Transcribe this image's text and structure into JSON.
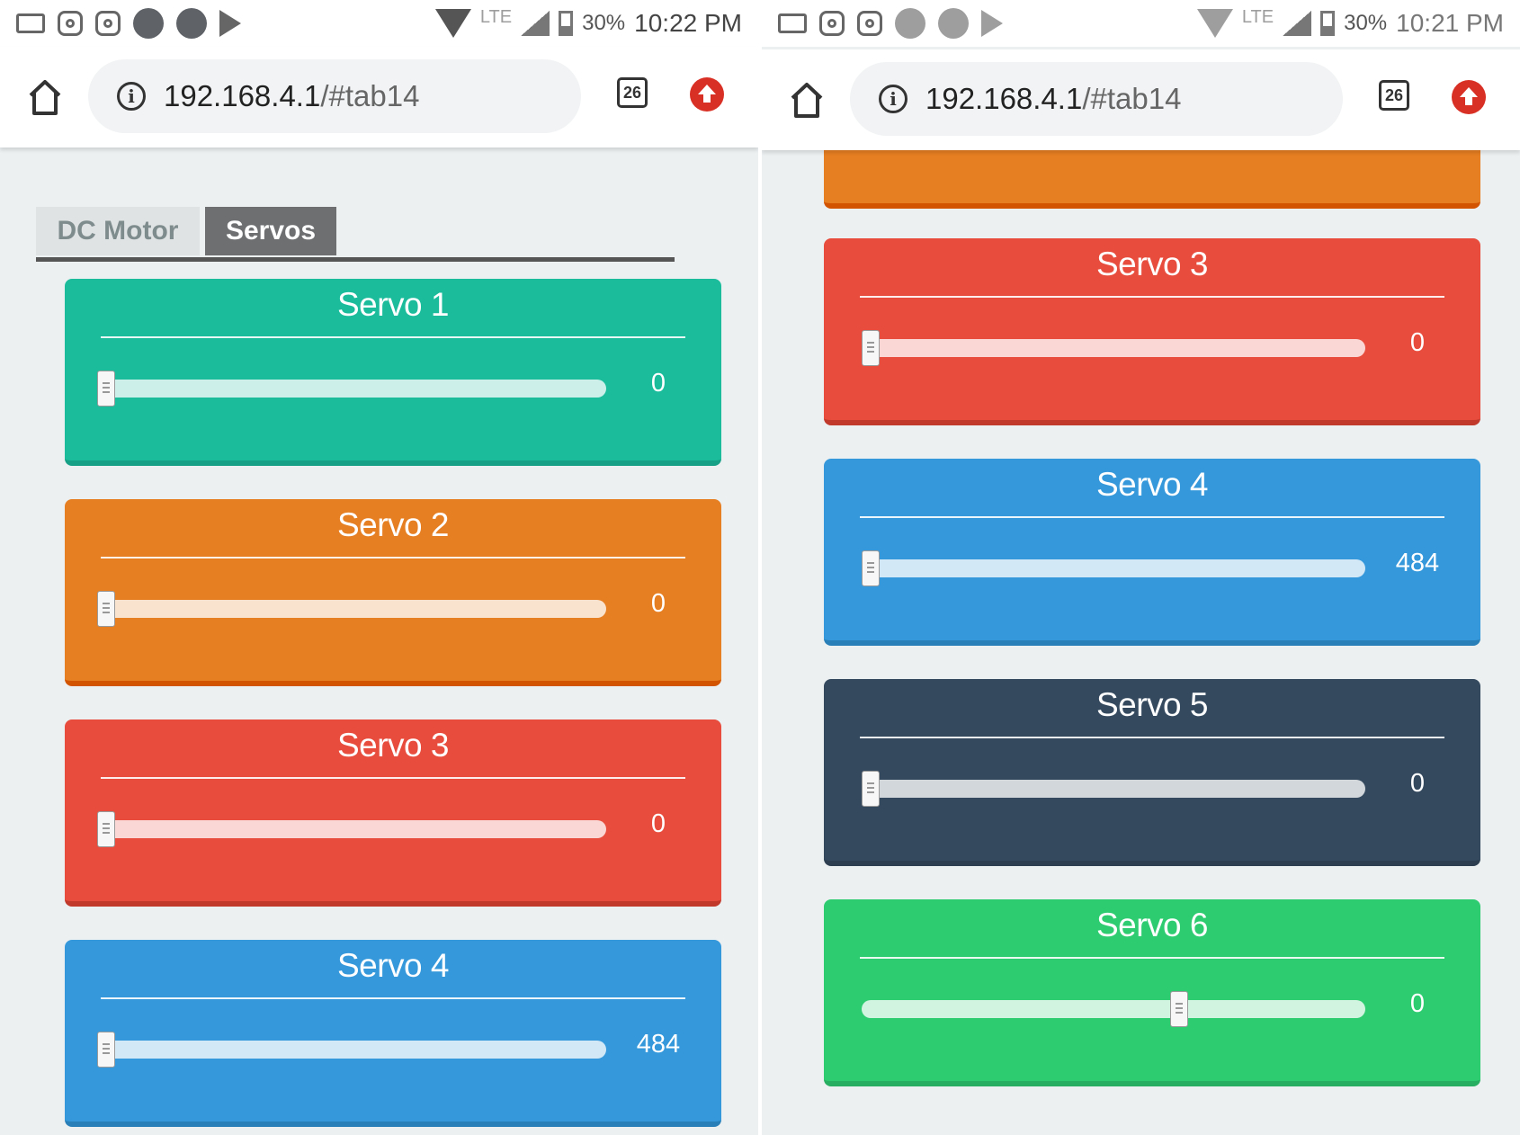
{
  "left": {
    "status": {
      "battery": "30%",
      "time": "10:22 PM",
      "network": "LTE"
    },
    "browser": {
      "url_host": "192.168.4.1",
      "url_path": "/#tab14",
      "tab_count": "26"
    },
    "tabs": [
      {
        "label": "DC Motor",
        "active": false
      },
      {
        "label": "Servos",
        "active": true
      }
    ],
    "servos": [
      {
        "title": "Servo 1",
        "value": "0",
        "color": "#1abc9c"
      },
      {
        "title": "Servo 2",
        "value": "0",
        "color": "#e67e22"
      },
      {
        "title": "Servo 3",
        "value": "0",
        "color": "#e74c3c"
      },
      {
        "title": "Servo 4",
        "value": "484",
        "color": "#3498db"
      }
    ]
  },
  "right": {
    "status": {
      "battery": "30%",
      "time": "10:21 PM",
      "network": "LTE"
    },
    "browser": {
      "url_host": "192.168.4.1",
      "url_path": "/#tab14",
      "tab_count": "26"
    },
    "servos": [
      {
        "title": "Servo 3",
        "value": "0",
        "color": "#e74c3c"
      },
      {
        "title": "Servo 4",
        "value": "484",
        "color": "#3498db"
      },
      {
        "title": "Servo 5",
        "value": "0",
        "color": "#34495e"
      },
      {
        "title": "Servo 6",
        "value": "0",
        "color": "#2ecc71",
        "slider_fraction": 0.63
      }
    ]
  }
}
